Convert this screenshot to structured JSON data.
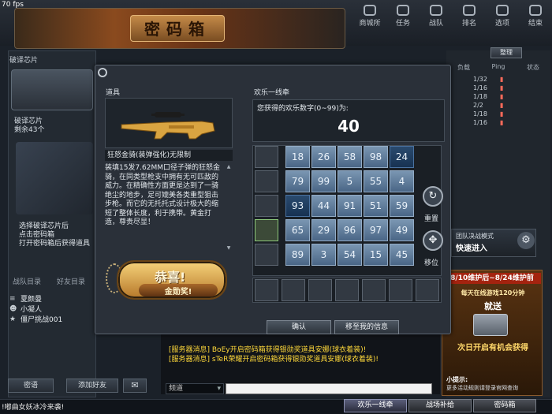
{
  "fps": "70 fps",
  "banner": {
    "title": "密码箱"
  },
  "topnav": [
    {
      "label": "商城所",
      "icon": "shop-icon"
    },
    {
      "label": "任务",
      "icon": "task-icon"
    },
    {
      "label": "战队",
      "icon": "clan-icon"
    },
    {
      "label": "排名",
      "icon": "trophy-icon"
    },
    {
      "label": "选项",
      "icon": "gear-icon"
    },
    {
      "label": "结束",
      "icon": "power-icon"
    }
  ],
  "left": {
    "title": "破译芯片",
    "chip_name": "破译芯片",
    "chip_count": "剩余43个",
    "instructions": [
      "选择破译芯片后",
      "点击密码箱",
      "打开密码箱后获得道具"
    ]
  },
  "friends": {
    "tabs": [
      "战队目录",
      "好友目录"
    ],
    "list": [
      {
        "icon": "rank-icon",
        "name": "夏颜曼"
      },
      {
        "icon": "frog-icon",
        "name": "小凝人"
      },
      {
        "icon": "star-icon",
        "name": "僵尸挑战001"
      }
    ],
    "chat_button": "密语",
    "add_button": "添加好友"
  },
  "rooms": {
    "refresh": "整理",
    "headers": [
      "负载",
      "Ping",
      "状态"
    ],
    "list": [
      {
        "load": "1/32"
      },
      {
        "load": "1/16"
      },
      {
        "load": "1/18"
      },
      {
        "load": "2/2"
      },
      {
        "load": "1/18"
      },
      {
        "load": "1/16"
      }
    ]
  },
  "mode": {
    "name": "团队决战模式",
    "enter": "快速进入"
  },
  "promo": {
    "date": "8/10维护后~8/24维护前",
    "online": "每天在线游戏120分钟",
    "get": "就送",
    "tomorrow": "次日开启有机会获得",
    "tip": "小提示:",
    "tip2": "更多活动规则请登录官网查询"
  },
  "chat": {
    "line1": "[服务器消息] BoEy开启密码箱获得银勋奖道具安娜(球衣着装)!",
    "line2": "[服务器消息] sTeR荣耀开启密码箱获得银勋奖道具安娜(球衣着装)!",
    "channel": "频道"
  },
  "status": {
    "ticker": "!嘟曲女妖冰冷来袭!",
    "btn1": "欢乐一线牵",
    "btn2": "战场补给",
    "btn3": "密码箱"
  },
  "dialog": {
    "item_label": "道具",
    "item_name": "狂怒金骑(装弹强化)无限制",
    "item_desc": "装填15发7.62MM口径子弹的狂怒金骑，在同类型枪支中拥有无可匹敌的威力。在精确性方面更是达到了一骑绝尘的地步，足可媲美各类重型狙击步枪。而它的无托托式设计极大的缩短了整体长度，利于携带。黄金打造，尊贵尽显！",
    "congrats": "恭喜!",
    "medal": "金勋奖!",
    "game_label": "欢乐一线牵",
    "number_label": "您获得的欢乐数字(0~99)为:",
    "number_value": "40",
    "grid": [
      [
        "18",
        "26",
        "58",
        "98",
        "24"
      ],
      [
        "79",
        "99",
        "5",
        "55",
        "4"
      ],
      [
        "93",
        "44",
        "91",
        "51",
        "59"
      ],
      [
        "65",
        "29",
        "96",
        "97",
        "49"
      ],
      [
        "89",
        "3",
        "54",
        "15",
        "45"
      ]
    ],
    "reset": "重置",
    "move": "移位",
    "ok": "确认",
    "msg": "移至我的信息"
  },
  "colors": {
    "cell": "#6888a8",
    "cell_selected": "#1e3c60",
    "gold": "#d9a441",
    "chat_system": "#ffd93a"
  }
}
